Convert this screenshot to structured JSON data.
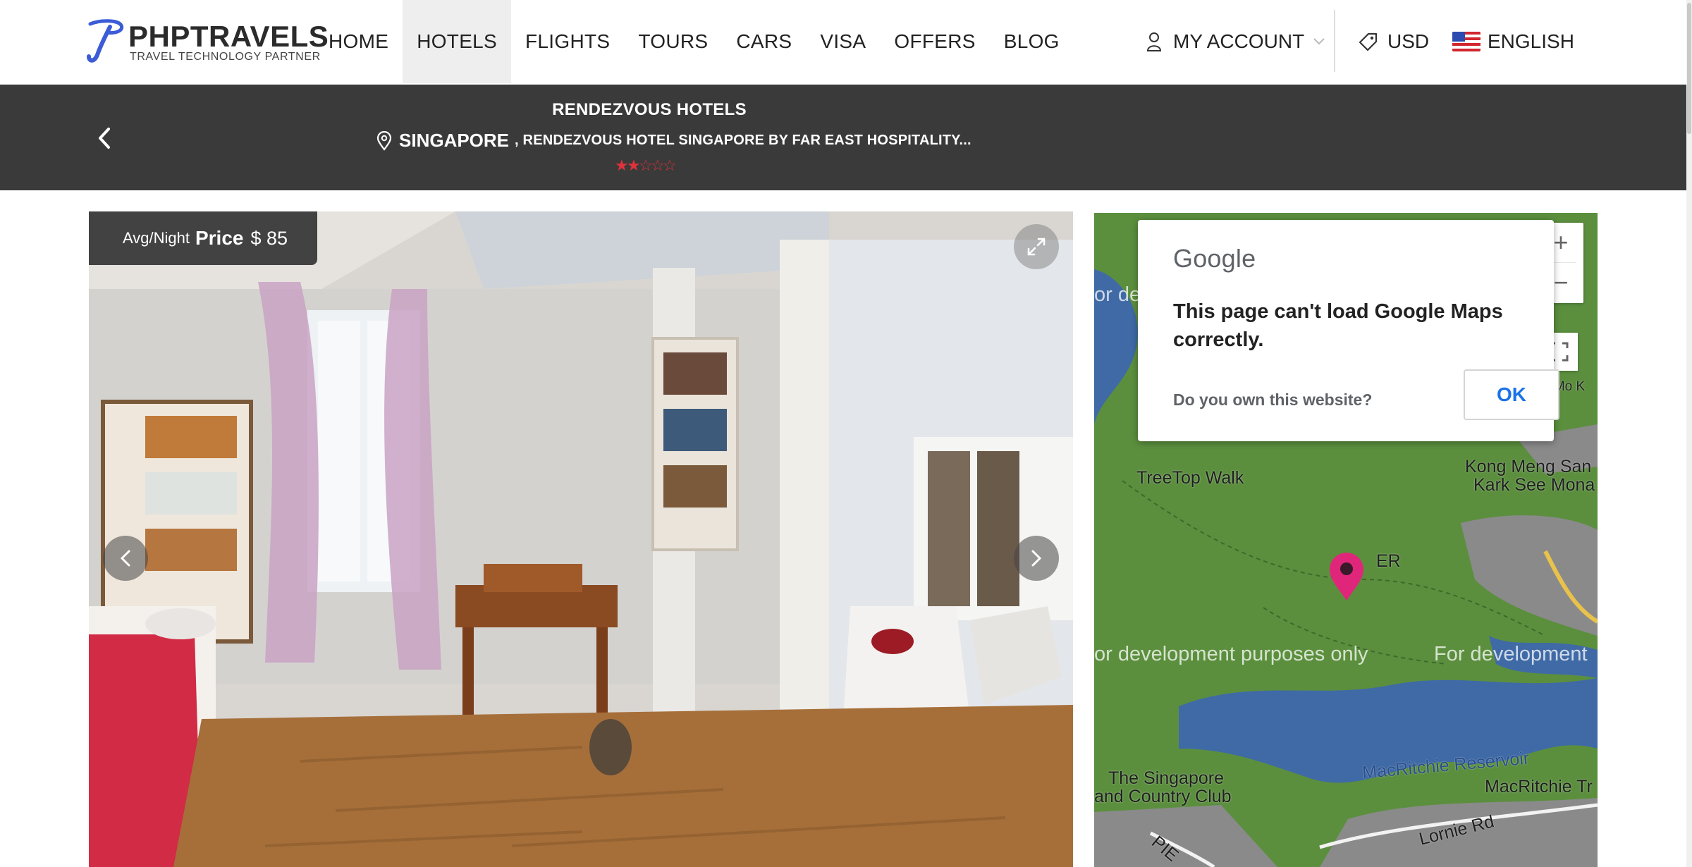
{
  "brand": {
    "name": "PHPTRAVELS",
    "tagline": "TRAVEL TECHNOLOGY PARTNER",
    "color": "#3b5cd6"
  },
  "nav": {
    "items": [
      "HOME",
      "HOTELS",
      "FLIGHTS",
      "TOURS",
      "CARS",
      "VISA",
      "OFFERS",
      "BLOG"
    ],
    "active": "HOTELS"
  },
  "header_right": {
    "account": "MY ACCOUNT",
    "currency": "USD",
    "language": "ENGLISH"
  },
  "hotel": {
    "name": "RENDEZVOUS HOTELS",
    "city": "SINGAPORE",
    "address": ", RENDEZVOUS HOTEL SINGAPORE BY FAR EAST HOSPITALITY...",
    "rating": 2,
    "max_rating": 5,
    "star_color": "#e0323b"
  },
  "gallery": {
    "price_label": "Avg/Night",
    "price_word": "Price",
    "price_value": "$ 85"
  },
  "map": {
    "dialog_logo": "Google",
    "dialog_message": "This page can't load Google Maps correctly.",
    "dialog_question": "Do you own this website?",
    "ok_label": "OK",
    "zoom_in": "+",
    "zoom_out": "−",
    "labels": {
      "treetop": "TreeTop Walk",
      "kong_meng_1": "Kong Meng San",
      "kong_meng_2": "Kark See Mona",
      "reservoir": "MacRitchie Reservoir",
      "macritchie_tr": "MacRitchie Tr",
      "club_1": "The Singapore",
      "club_2": "and Country Club",
      "lornie": "Lornie Rd",
      "pie": "PIE",
      "er": "ER",
      "mo_k": "g Mo K",
      "dev_top": "or dev",
      "dev_mid_left": "or development purposes only",
      "dev_mid_right": "For development"
    },
    "colors": {
      "land": "#5b8f3e",
      "water": "#3f6aa6",
      "urban": "#8a8a8a",
      "pin": "#e0267a"
    }
  }
}
